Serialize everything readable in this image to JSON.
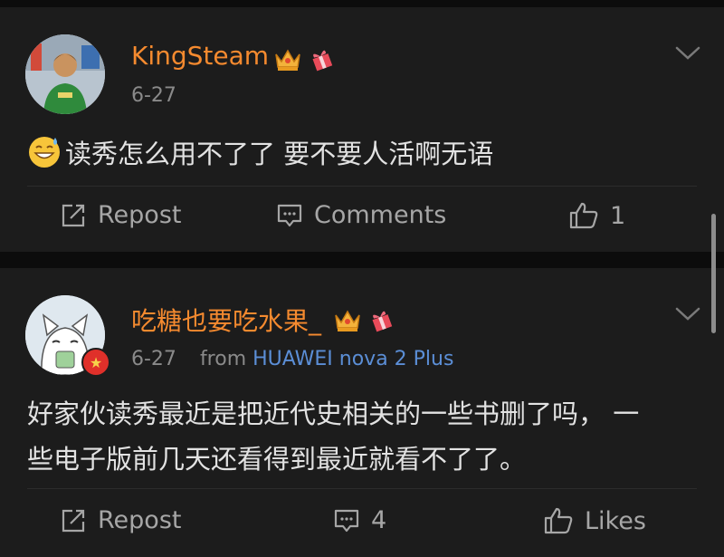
{
  "comments": [
    {
      "username": "KingSteam",
      "date": "6-27",
      "source_prefix": "",
      "source": "",
      "emoji": "grinning-sweat-emoji",
      "text": "读秀怎么用不了了 要不要人活啊无语",
      "repost_label": "Repost",
      "comments_label": "Comments",
      "like_count": "1"
    },
    {
      "username": "吃糖也要吃水果_",
      "date": "6-27",
      "source_prefix": "from",
      "source": "HUAWEI nova 2 Plus",
      "text_line1": "好家伙读秀最近是把近代史相关的一些书删了吗， 一",
      "text_line2": "些电子版前几天还看得到最近就看不了了。",
      "repost_label": "Repost",
      "comment_count": "4",
      "likes_label": "Likes"
    }
  ],
  "colors": {
    "background": "#0c0c0c",
    "card": "#1c1c1c",
    "username": "#f58a2f",
    "meta": "#8a8a8a",
    "source_link": "#5b8ed6",
    "action": "#a6a6a6"
  }
}
